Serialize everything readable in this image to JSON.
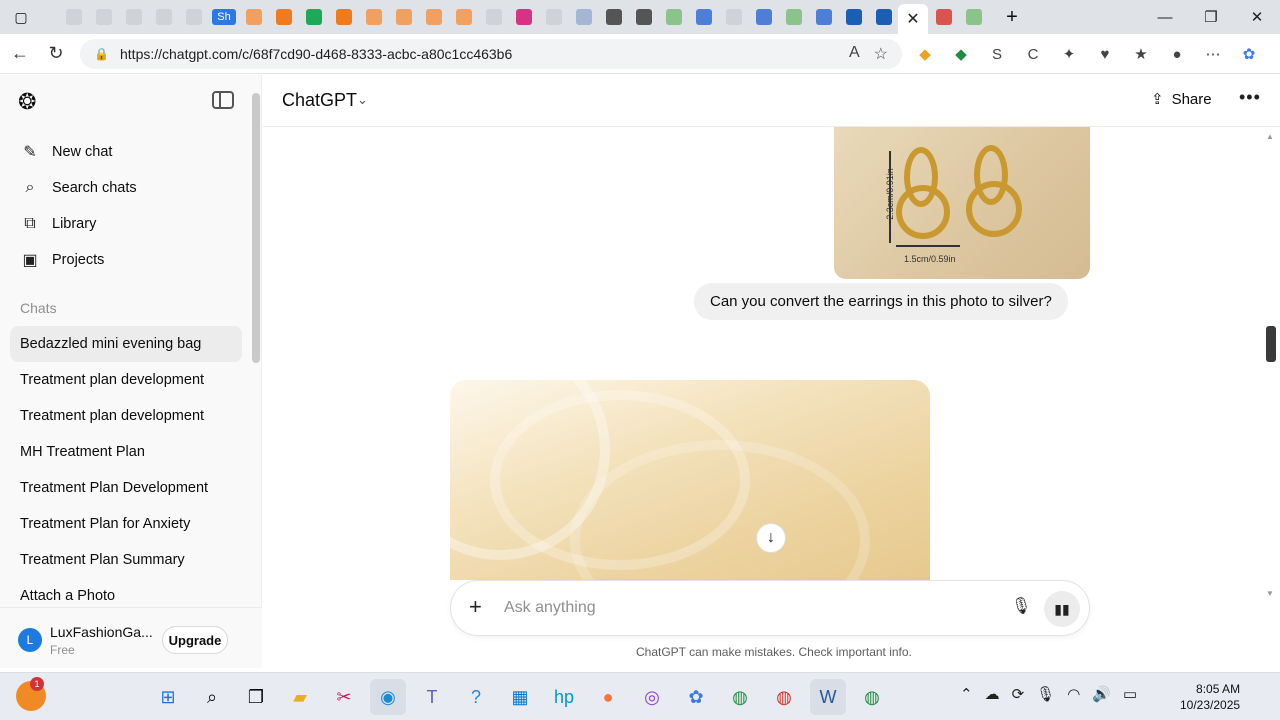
{
  "browser": {
    "url": "https://chatgpt.com/c/68f7cd90-d468-8333-acbc-a80c1cc463b6",
    "active_tab_close": "✕",
    "tab_colors": [
      "#cfd3d8",
      "#cfd3d8",
      "#cfd3d8",
      "#cfd3d8",
      "#cfd3d8",
      "#2b78e4",
      "#f0a060",
      "#f07b1f",
      "#1fa855",
      "#f07b1f",
      "#f0a060",
      "#f0a060",
      "#f0a060",
      "#f0a060",
      "#cfd3d8",
      "#d63384",
      "#cfd3d8",
      "#a3b6d4",
      "#555555",
      "#555555",
      "#8bc48a",
      "#4d7fd6",
      "#cfd3d8",
      "#4d7fd6",
      "#8bc48a",
      "#4d7fd6",
      "#1a5fb4",
      "#1a5fb4"
    ],
    "sh_tab_label": "Sh"
  },
  "sidebar": {
    "actions": [
      {
        "label": "New chat",
        "icon": "new-chat-icon"
      },
      {
        "label": "Search chats",
        "icon": "search-icon"
      },
      {
        "label": "Library",
        "icon": "library-icon"
      },
      {
        "label": "Projects",
        "icon": "projects-icon"
      }
    ],
    "section_label": "Chats",
    "chats": [
      "Bedazzled mini evening bag",
      "Treatment plan development",
      "Treatment plan development",
      "MH Treatment Plan",
      "Treatment Plan Development",
      "Treatment Plan for Anxiety",
      "Treatment Plan Summary",
      "Attach a Photo"
    ],
    "user": {
      "initial": "L",
      "name": "LuxFashionGa...",
      "plan": "Free",
      "upgrade_label": "Upgrade"
    }
  },
  "header": {
    "model": "ChatGPT",
    "share_label": "Share"
  },
  "conversation": {
    "image_dim_vertical": "2.3cm/0.91in",
    "image_dim_horizontal": "1.5cm/0.59in",
    "user_message": "Can you convert the earrings in this photo to silver?"
  },
  "composer": {
    "placeholder": "Ask anything"
  },
  "disclaimer": "ChatGPT can make mistakes. Check important info.",
  "taskbar": {
    "time": "8:05 AM",
    "date": "10/23/2025",
    "notification_count": "1"
  }
}
